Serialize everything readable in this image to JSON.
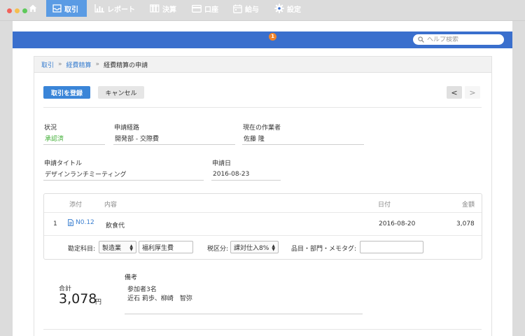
{
  "nav": {
    "items": [
      {
        "label": "",
        "icon": "home-icon"
      },
      {
        "label": "取引",
        "icon": "inbox-icon",
        "active": true
      },
      {
        "label": "レポート",
        "icon": "bar-chart-icon"
      },
      {
        "label": "決算",
        "icon": "books-icon"
      },
      {
        "label": "口座",
        "icon": "card-icon"
      },
      {
        "label": "給与",
        "icon": "calendar-icon"
      },
      {
        "label": "設定",
        "icon": "gear-icon"
      }
    ],
    "settings_badge": "1",
    "search_placeholder": "ヘルプ検索"
  },
  "breadcrumb": {
    "items": [
      "取引",
      "経費精算",
      "経費精算の申請"
    ],
    "separator": "»"
  },
  "toolbar": {
    "register_label": "取引を登録",
    "cancel_label": "キャンセル",
    "prev_label": "<",
    "next_label": ">"
  },
  "form": {
    "status_label": "状況",
    "status_value": "承認済",
    "route_label": "申請経路",
    "route_value": "開発部 - 交際費",
    "worker_label": "現在の作業者",
    "worker_value": "佐藤 隆",
    "title_label": "申請タイトル",
    "title_value": "デザインランチミーティング",
    "date_label": "申請日",
    "date_value": "2016-08-23"
  },
  "table": {
    "headers": {
      "attachment": "添付",
      "content": "内容",
      "date": "日付",
      "amount": "金額"
    },
    "rows": [
      {
        "index": "1",
        "file": "N0.12",
        "content": "飲食代",
        "date": "2016-08-20",
        "amount": "3,078"
      }
    ],
    "account_label": "勘定科目:",
    "account_select": "製造業",
    "account_input": "福利厚生費",
    "tax_label": "税区分:",
    "tax_select": "課対仕入8%",
    "tag_label": "品目・部門・メモタグ:",
    "tag_input": ""
  },
  "totals": {
    "label": "合計",
    "amount": "3,078",
    "unit": "円"
  },
  "notes": {
    "label": "備考",
    "lines": [
      "参加者3名",
      "近石 莉歩、柳崎　智弥"
    ]
  },
  "colors": {
    "nav_bg": "#3a6fcd",
    "nav_active": "#5a9be4",
    "primary_button": "#3a85d8",
    "status_green": "#3fae34",
    "badge": "#f0842c",
    "link": "#3a7fd0"
  }
}
